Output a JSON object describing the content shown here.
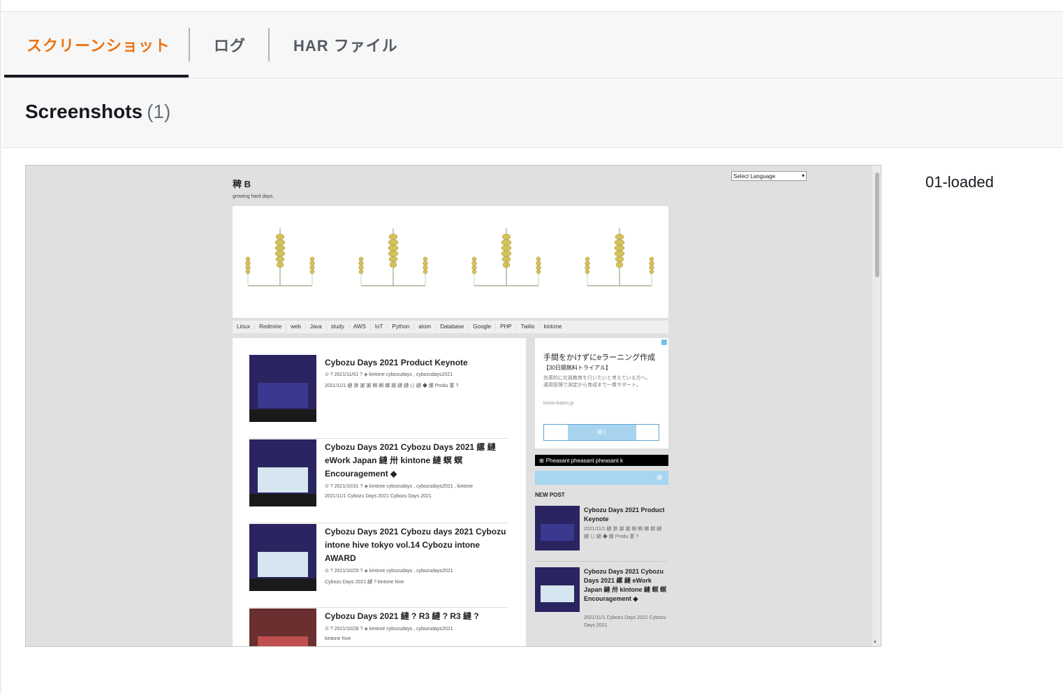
{
  "tabs": [
    {
      "label": "スクリーンショット",
      "active": true
    },
    {
      "label": "ログ",
      "active": false
    },
    {
      "label": "HAR ファイル",
      "active": false
    }
  ],
  "section": {
    "title": "Screenshots",
    "count": "(1)"
  },
  "screenshot": {
    "label": "01-loaded",
    "page": {
      "site_title": "稗 B",
      "tagline": "growing hard days.",
      "language_select": "Select Language",
      "nav": [
        "Linux",
        "Redmine",
        "web",
        "Java",
        "study",
        "AWS",
        "IoT",
        "Python",
        "atom",
        "Database",
        "Google",
        "PHP",
        "Twilio",
        "kintone"
      ],
      "posts": [
        {
          "title": "Cybozu Days 2021 Product Keynote",
          "meta": "⊙ ? 2021/11/01 ? ◈ kintone cybozudays , cybozudays2021",
          "excerpt": "2021/11/1 縺 渺 謝 謝 蝌 蝌 螂 謝 縺 縺 ∪ 縺 ◆ 縲 Produ 菫 ?"
        },
        {
          "title": "Cybozu Days 2021 Cybozu Days 2021 縲 縺 eWork Japan 縺 卅 kintone 縺 螟 螟 Encouragement ◆",
          "meta": "⊙ ? 2021/10/31 ? ◈ kintone cybozudays , cybozudays2021 , kintone",
          "excerpt": "2021/11/1 Cybozu Days 2021 Cybozu Days 2021"
        },
        {
          "title": "Cybozu Days 2021 Cybozu days 2021 Cybozu intone hive tokyo vol.14 Cybozu intone AWARD",
          "meta": "⊙ ? 2021/10/29 ? ◈ kintone cybozudays , cybozudays2021",
          "excerpt": "Cybozu Days 2021 縺 ? kintone hive"
        },
        {
          "title": "Cybozu Days 2021 縺 ? R3 縺 ? R3 縺 ?",
          "meta": "⊙ ? 2021/10/28 ? ◈ kintone cybozudays , cybozudays2021",
          "excerpt": "kintone hive"
        }
      ],
      "ad": {
        "title": "手間をかけずにeラーニング作成",
        "subtitle": "【30日間無料トライアル】",
        "desc": "効率的に社員教育を行いたいと考えている方へ。運用管理で測定から育成まで一貫サポート。",
        "url": "know-baton.jp",
        "button": "開く"
      },
      "rss": "Pheasant pheasant pheasant k",
      "new_post_heading": "NEW POST",
      "new_posts": [
        {
          "title": "Cybozu Days 2021 Product Keynote",
          "excerpt": "2021/11/1 縺 渺 謝 謝 蝌 蝌 螂 謝 縺 縺 ∪ 縺 ◆ 縲 Produ 菫 ?"
        },
        {
          "title": "Cybozu Days 2021 Cybozu Days 2021 縲 縺 eWork Japan 縺 卅 kintone 縺 螟 螟 Encouragement ◆",
          "excerpt": "2021/11/1 Cybozu Days 2021 Cybozu Days 2021"
        }
      ]
    }
  },
  "colors": {
    "active_tab": "#ec7211",
    "inactive_tab": "#545b64",
    "underline": "#16191f"
  }
}
